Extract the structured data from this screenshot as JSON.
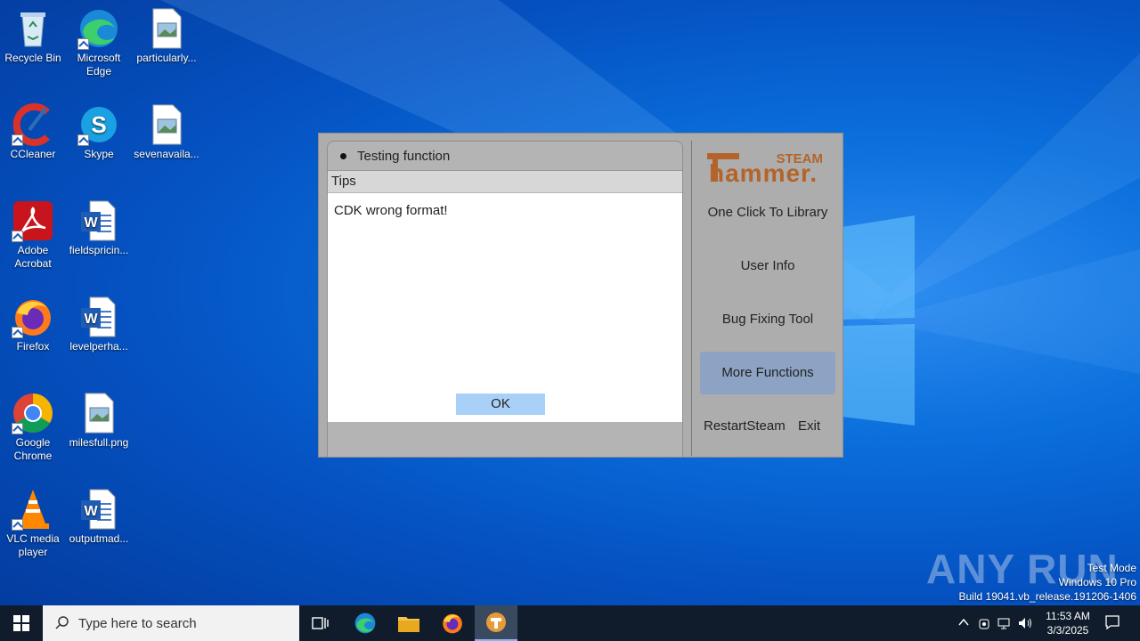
{
  "desktop": {
    "icons": [
      {
        "label": "Recycle Bin",
        "icon": "recycle-bin-icon"
      },
      {
        "label": "Microsoft Edge",
        "icon": "edge-icon"
      },
      {
        "label": "particularly...",
        "icon": "image-file-icon"
      },
      {
        "label": "CCleaner",
        "icon": "ccleaner-icon"
      },
      {
        "label": "Skype",
        "icon": "skype-icon"
      },
      {
        "label": "sevenavaila...",
        "icon": "image-file-icon"
      },
      {
        "label": "Adobe Acrobat",
        "icon": "acrobat-icon"
      },
      {
        "label": "fieldspricin...",
        "icon": "word-doc-icon"
      },
      {
        "label": "Firefox",
        "icon": "firefox-icon"
      },
      {
        "label": "levelperha...",
        "icon": "word-doc-icon"
      },
      {
        "label": "Google Chrome",
        "icon": "chrome-icon"
      },
      {
        "label": "milesfull.png",
        "icon": "image-file-icon"
      },
      {
        "label": "VLC media player",
        "icon": "vlc-icon"
      },
      {
        "label": "outputmad...",
        "icon": "word-doc-icon"
      }
    ]
  },
  "app": {
    "panel_title": "Testing function",
    "tips_label": "Tips",
    "message": "CDK wrong format!",
    "ok_label": "OK",
    "logo_top": "STEAM",
    "logo_main": "hammer.",
    "menu": {
      "one_click": "One Click To Library",
      "user_info": "User Info",
      "bug_fixing": "Bug Fixing Tool",
      "more_functions": "More Functions",
      "restart_steam": "RestartSteam",
      "exit": "Exit"
    },
    "accent": "#a9d0f7",
    "active_menu_color": "#8da3c3"
  },
  "watermark": {
    "brand": "ANY RUN",
    "test_mode": "Test Mode",
    "os": "Windows 10 Pro",
    "build": "Build 19041.vb_release.191206-1406"
  },
  "taskbar": {
    "search_placeholder": "Type here to search",
    "time": "11:53 AM",
    "date": "3/3/2025"
  }
}
